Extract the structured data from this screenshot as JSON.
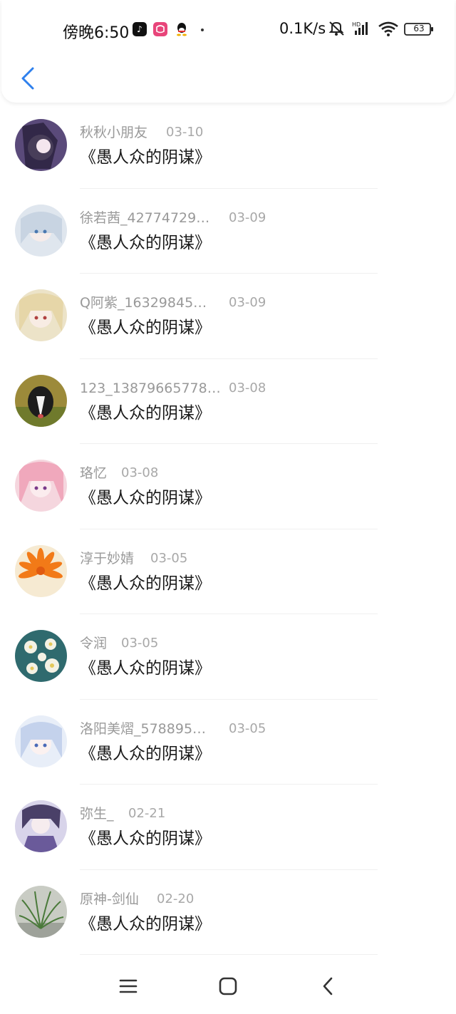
{
  "status_bar": {
    "time": "傍晚6:50",
    "network_speed": "0.1K/s",
    "battery": "63",
    "icons": [
      "tiktok-icon",
      "app-red-icon",
      "qq-icon",
      "mute-icon",
      "signal-icon",
      "wifi-icon",
      "battery-icon"
    ]
  },
  "header": {
    "back_icon": "chevron-left-icon"
  },
  "colors": {
    "accent": "#2f80ed",
    "meta_text": "#999999",
    "title_text": "#1a1a1a",
    "divider": "#f0f0f0"
  },
  "items": [
    {
      "username": "秋秋小朋友",
      "date": "03-10",
      "title": "《愚人众的阴谋》"
    },
    {
      "username": "徐若茜_42774729…",
      "date": "03-09",
      "title": "《愚人众的阴谋》"
    },
    {
      "username": "Q阿紫_16329845…",
      "date": "03-09",
      "title": "《愚人众的阴谋》"
    },
    {
      "username": "123_13879665778…",
      "date": "03-08",
      "title": "《愚人众的阴谋》"
    },
    {
      "username": "珞忆",
      "date": "03-08",
      "title": "《愚人众的阴谋》"
    },
    {
      "username": "淳于妙婧",
      "date": "03-05",
      "title": "《愚人众的阴谋》"
    },
    {
      "username": "令润",
      "date": "03-05",
      "title": "《愚人众的阴谋》"
    },
    {
      "username": "洛阳美熠_578895…",
      "date": "03-05",
      "title": "《愚人众的阴谋》"
    },
    {
      "username": "弥生_",
      "date": "02-21",
      "title": "《愚人众的阴谋》"
    },
    {
      "username": "原神-剑仙",
      "date": "02-20",
      "title": "《愚人众的阴谋》"
    }
  ],
  "nav": {
    "menu_icon": "menu-icon",
    "home_icon": "home-square-icon",
    "back_icon": "back-triangle-icon"
  }
}
